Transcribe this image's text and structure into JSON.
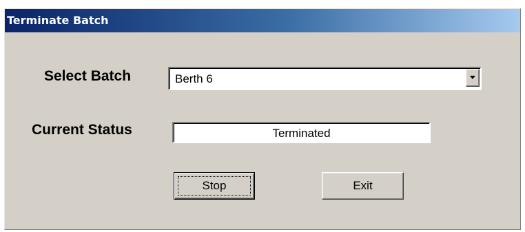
{
  "window": {
    "title": "Terminate Batch"
  },
  "form": {
    "select_batch_label": "Select Batch",
    "select_batch_value": "Berth 6",
    "current_status_label": "Current Status",
    "current_status_value": "Terminated"
  },
  "buttons": {
    "stop_label": "Stop",
    "exit_label": "Exit"
  },
  "icons": {
    "dropdown": "chevron-down-icon"
  },
  "colors": {
    "window_face": "#d4d0c8",
    "title_gradient_start": "#0a246a",
    "title_gradient_end": "#a6caf0",
    "title_text": "#ffffff"
  }
}
